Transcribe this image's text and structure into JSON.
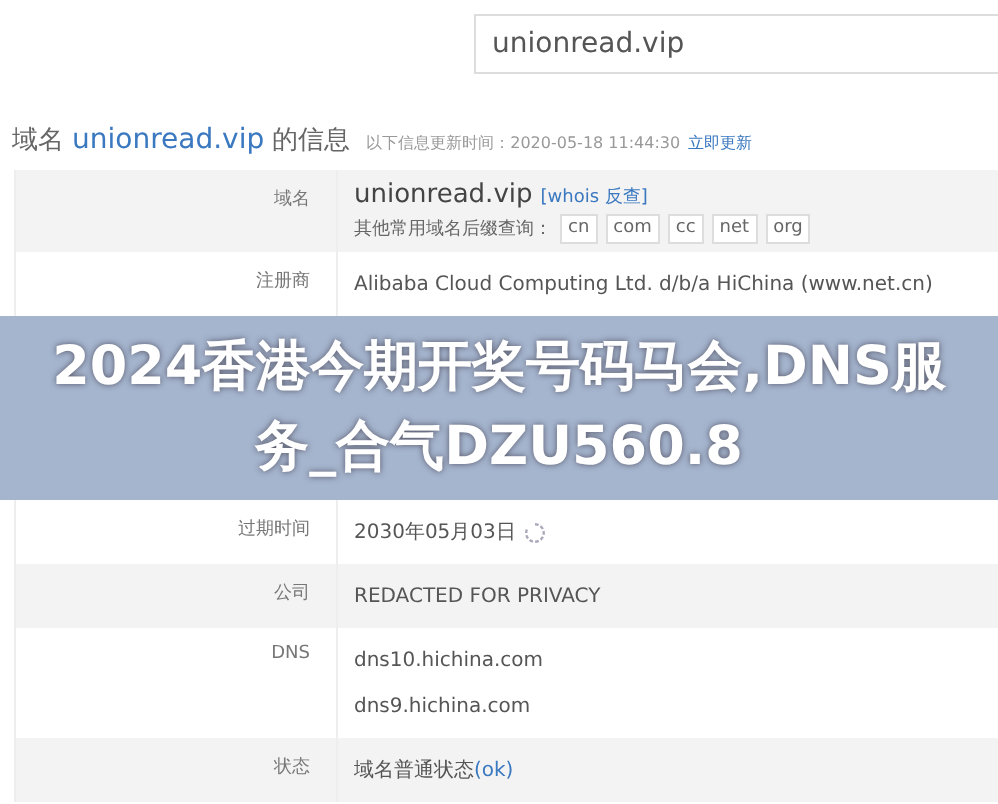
{
  "search": {
    "value": "unionread.vip"
  },
  "heading": {
    "prefix": "域名",
    "domain": "unionread.vip",
    "suffix": "的信息",
    "update_note": "以下信息更新时间：2020-05-18 11:44:30",
    "update_link": "立即更新"
  },
  "rows": [
    {
      "kind": "domain",
      "label": "域名",
      "domain": "unionread.vip",
      "whois_link": "[whois 反查]",
      "suffix_label": "其他常用域名后缀查询：",
      "suffixes": [
        "cn",
        "com",
        "cc",
        "net",
        "org"
      ]
    },
    {
      "kind": "text",
      "label": "注册商",
      "values": [
        "Alibaba Cloud Computing Ltd. d/b/a HiChina (www.net.cn)"
      ]
    },
    {
      "kind": "banner",
      "text": "2024香港今期开奖号码马会,DNS服务_合气DZU560.8"
    },
    {
      "kind": "expiry",
      "label": "过期时间",
      "value": "2030年05月03日"
    },
    {
      "kind": "text",
      "label": "公司",
      "values": [
        "REDACTED FOR PRIVACY"
      ]
    },
    {
      "kind": "text",
      "label": "DNS",
      "values": [
        "dns10.hichina.com",
        "dns9.hichina.com"
      ]
    },
    {
      "kind": "status",
      "label": "状态",
      "status_text": "域名普通状态",
      "status_link": "(ok)"
    }
  ]
}
